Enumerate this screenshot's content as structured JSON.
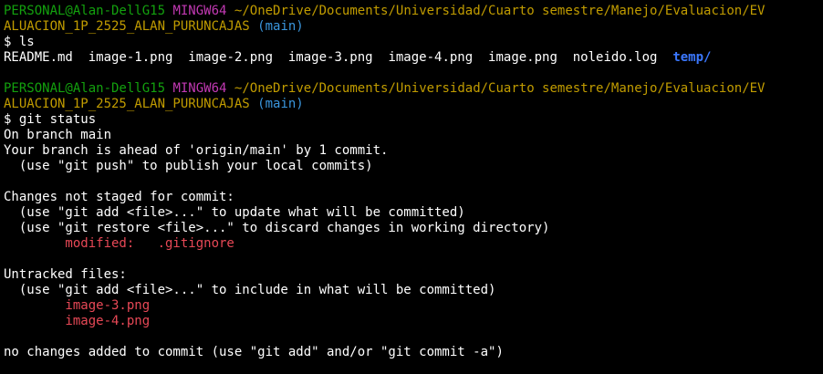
{
  "prompt1": {
    "user_host": "PERSONAL@Alan-DellG15",
    "shell": "MINGW64",
    "path_part1": "~/OneDrive/Documents/Universidad/Cuarto semestre/Manejo/Evaluacion/EV",
    "path_part2": "ALUACION_1P_2525_ALAN_PURUNCAJAS",
    "branch": "(main)",
    "command": "$ ls"
  },
  "ls_output": {
    "files": [
      "README.md",
      "image-1.png",
      "image-2.png",
      "image-3.png",
      "image-4.png",
      "image.png",
      "noleido.log"
    ],
    "directory": "temp/"
  },
  "prompt2": {
    "user_host": "PERSONAL@Alan-DellG15",
    "shell": "MINGW64",
    "path_part1": "~/OneDrive/Documents/Universidad/Cuarto semestre/Manejo/Evaluacion/EV",
    "path_part2": "ALUACION_1P_2525_ALAN_PURUNCAJAS",
    "branch": "(main)",
    "command": "$ git status"
  },
  "status": {
    "on_branch": "On branch main",
    "ahead": "Your branch is ahead of 'origin/main' by 1 commit.",
    "push_hint": "  (use \"git push\" to publish your local commits)",
    "not_staged_header": "Changes not staged for commit:",
    "add_hint": "  (use \"git add <file>...\" to update what will be committed)",
    "restore_hint": "  (use \"git restore <file>...\" to discard changes in working directory)",
    "modified_label": "        modified:   .gitignore",
    "untracked_header": "Untracked files:",
    "untracked_hint": "  (use \"git add <file>...\" to include in what will be committed)",
    "untracked_files": [
      "        image-3.png",
      "        image-4.png"
    ],
    "summary": "no changes added to commit (use \"git add\" and/or \"git commit -a\")"
  },
  "colors": {
    "user_host": "#13a10e",
    "shell": "#c239b3",
    "path": "#c19c00",
    "branch": "#3a96dd",
    "red": "#e74856",
    "directory": "#3b78ff",
    "background": "#000000",
    "text": "#ffffff"
  }
}
